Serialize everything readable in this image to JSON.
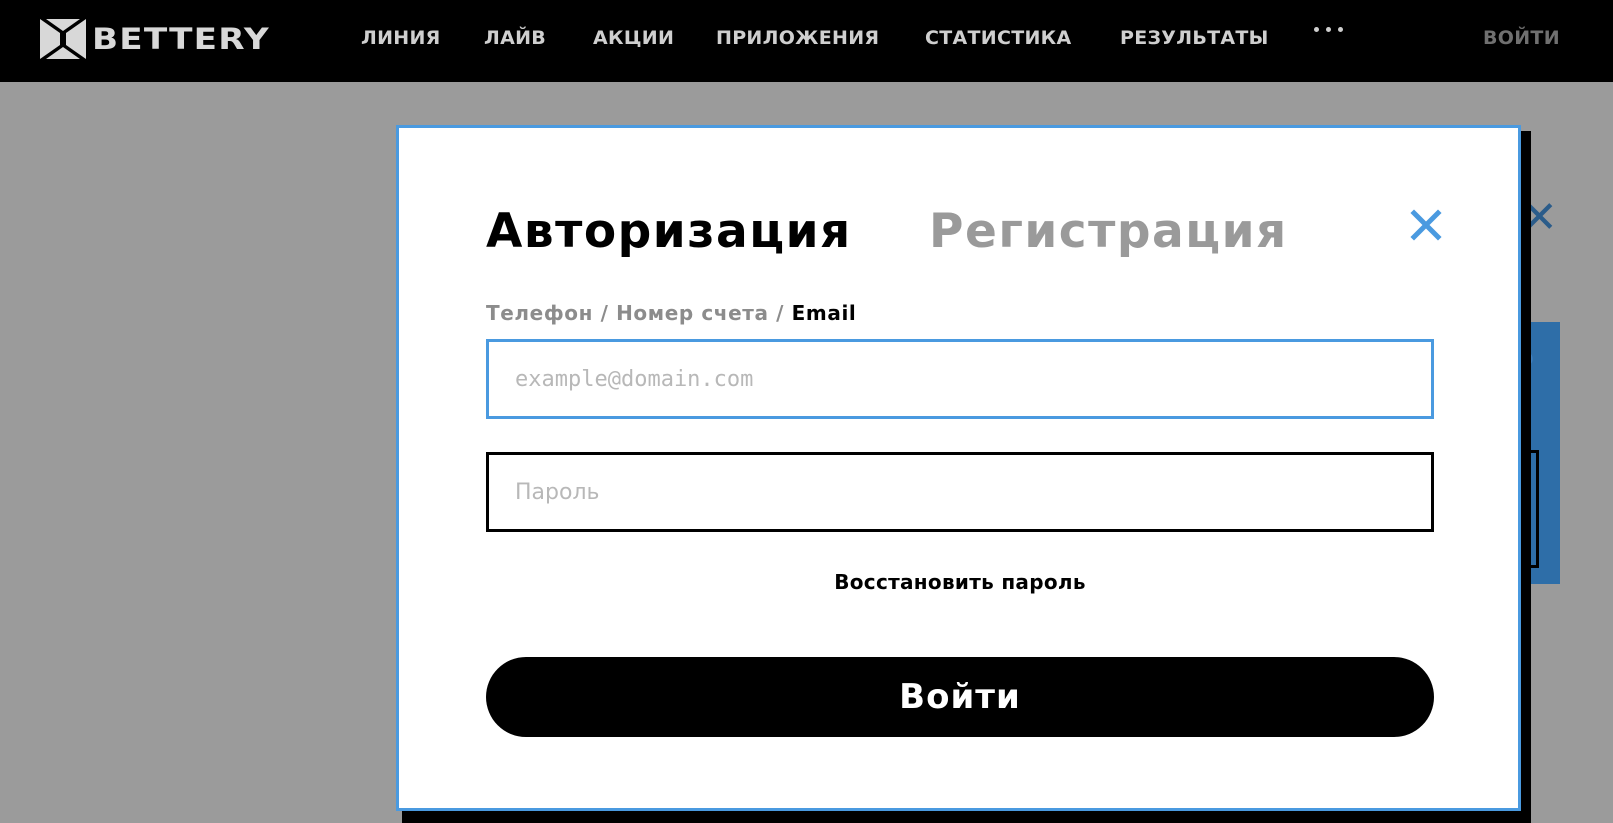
{
  "header": {
    "logo_text": "BETTERY",
    "nav": [
      {
        "label": "ЛИНИЯ"
      },
      {
        "label": "ЛАЙВ"
      },
      {
        "label": "АКЦИИ"
      },
      {
        "label": "ПРИЛОЖЕНИЯ"
      },
      {
        "label": "СТАТИСТИКА"
      },
      {
        "label": "РЕЗУЛЬТАТЫ"
      }
    ],
    "more_icon": "more-dots-icon",
    "login_label": "ВОЙТИ"
  },
  "modal": {
    "tabs": {
      "login": "Авторизация",
      "register": "Регистрация"
    },
    "close_icon": "close-icon",
    "login_types": {
      "phone": "Телефон",
      "account": "Номер счета",
      "email": "Email",
      "separator": "/",
      "selected": "Email"
    },
    "email_placeholder": "example@domain.com",
    "password_placeholder": "Пароль",
    "restore_label": "Восстановить пароль",
    "submit_label": "Войти"
  },
  "colors": {
    "accent": "#4a9ae0",
    "header_bg": "#000000",
    "overlay": "#9b9b9b"
  }
}
